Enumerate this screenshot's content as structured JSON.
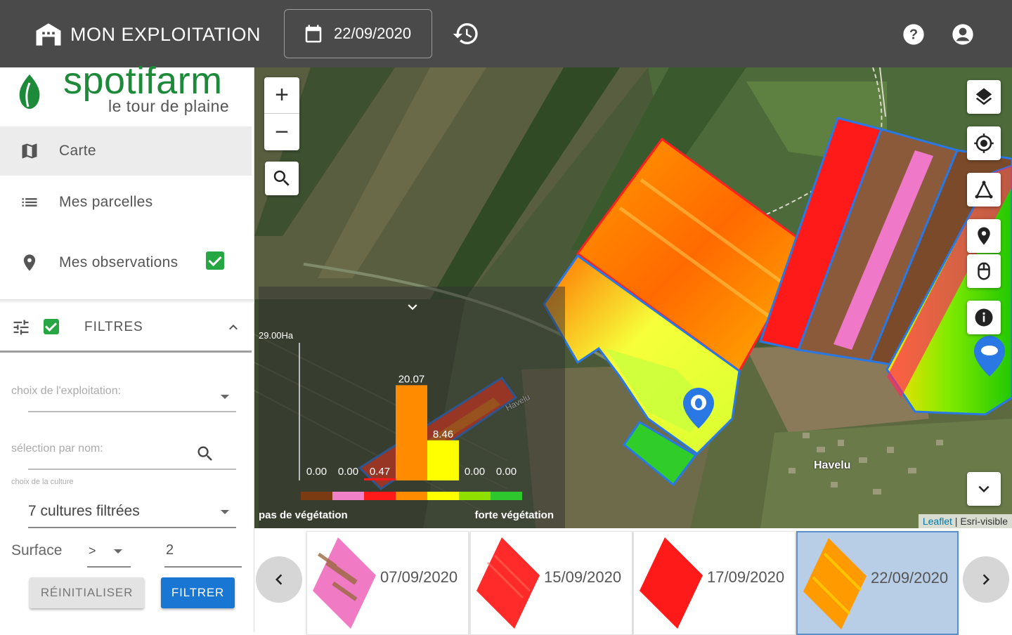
{
  "app": {
    "title": "MON EXPLOITATION",
    "date": "22/09/2020"
  },
  "logo": {
    "name": "spotifarm",
    "tagline": "le tour de plaine"
  },
  "nav": {
    "carte": "Carte",
    "parcelles": "Mes parcelles",
    "observations": "Mes observations"
  },
  "filters": {
    "title": "FILTRES",
    "exploitation_placeholder": "choix de l'exploitation:",
    "name_placeholder": "sélection par nom:",
    "culture_label": "choix de la culture",
    "culture_value": "7 cultures filtrées",
    "surface_label": "Surface",
    "surface_operator": ">",
    "surface_value": "2",
    "reset_label": "RÉINITIALISER",
    "filter_label": "FILTRER"
  },
  "map": {
    "attribution_leaflet": "Leaflet",
    "attribution_rest": " | Esri-visible",
    "place_label": "Havelu",
    "parcel_label": "Havelu"
  },
  "chart_data": {
    "type": "bar",
    "y_max_label": "29.00Ha",
    "categories": [
      "brown",
      "pink",
      "red",
      "orange",
      "yellow",
      "light-green",
      "green"
    ],
    "category_colors": [
      "#7a3b12",
      "#f080c8",
      "#ff1a1a",
      "#ff8c00",
      "#ffff00",
      "#8fe000",
      "#2ec82e"
    ],
    "values": [
      0.0,
      0.0,
      0.47,
      20.07,
      8.46,
      0.0,
      0.0
    ],
    "value_labels": [
      "0.00",
      "0.00",
      "0.47",
      "20.07",
      "8.46",
      "0.00",
      "0.00"
    ],
    "xlabel_left": "pas de végétation",
    "xlabel_right": "forte végétation",
    "ylim": [
      0,
      29
    ]
  },
  "timeline": {
    "dates": [
      "07/09/2020",
      "15/09/2020",
      "17/09/2020",
      "22/09/2020"
    ],
    "selected": "22/09/2020"
  }
}
